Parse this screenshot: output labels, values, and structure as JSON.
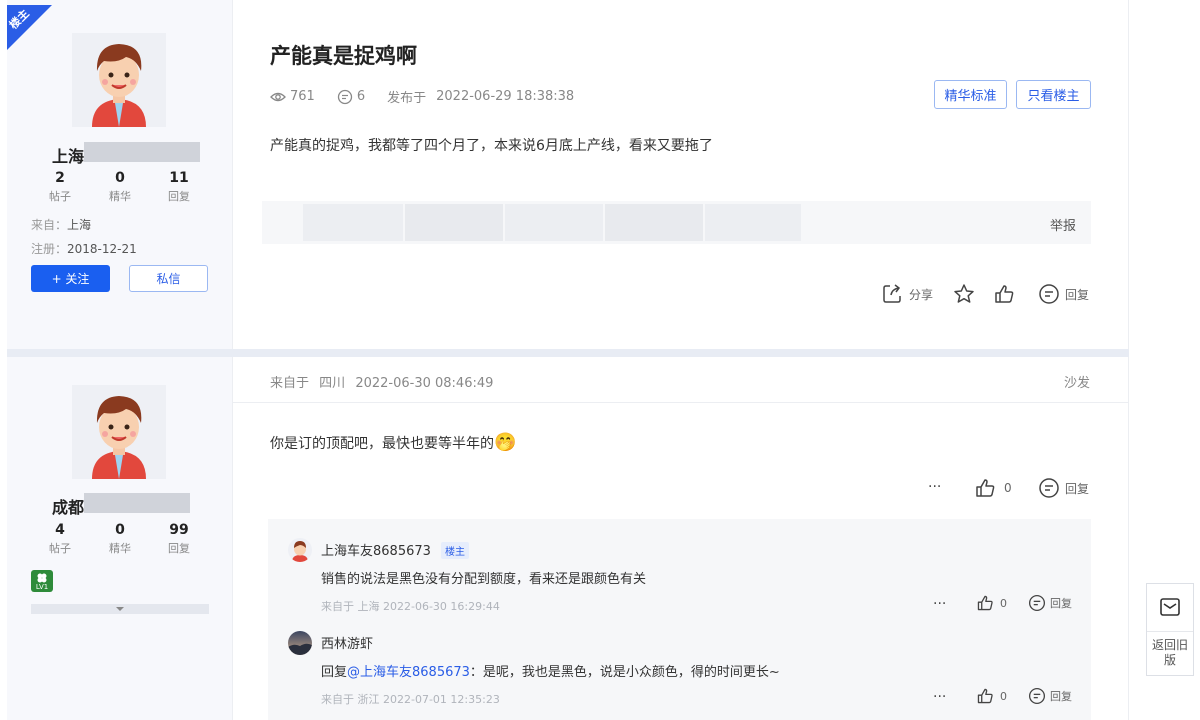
{
  "op_badge": "楼主",
  "post": {
    "title": "产能真是捉鸡啊",
    "views": "761",
    "comments": "6",
    "published_prefix": "发布于",
    "published_time": "2022-06-29 18:38:38",
    "btn_essence_standard": "精华标准",
    "btn_only_op": "只看楼主",
    "content": "产能真的捉鸡，我都等了四个月了，本来说6月底上产线，看来又要拖了",
    "report": "举报",
    "share": "分享",
    "reply": "回复"
  },
  "author": {
    "name": "上海",
    "posts": "2",
    "posts_label": "帖子",
    "essence": "0",
    "essence_label": "精华",
    "replies": "11",
    "replies_label": "回复",
    "from_label": "来自：",
    "from_value": "上海",
    "reg_label": "注册：",
    "reg_value": "2018-12-21",
    "follow_label": "+ 关注",
    "message_label": "私信"
  },
  "reply1": {
    "header_prefix": "来自于",
    "location": "四川",
    "time": "2022-06-30 08:46:49",
    "floor": "沙发",
    "content": "你是订的顶配吧，最快也要等半年的",
    "emoji": "🤭",
    "likes": "0",
    "reply": "回复",
    "more": "···",
    "user": {
      "name": "成都",
      "posts": "4",
      "posts_label": "帖子",
      "essence": "0",
      "essence_label": "精华",
      "replies": "99",
      "replies_label": "回复",
      "level": "LV1"
    }
  },
  "subreplies": [
    {
      "name": "上海车友8685673",
      "badge": "楼主",
      "content": "销售的说法是黑色没有分配到额度，看来还是跟颜色有关",
      "meta": "来自于 上海 2022-06-30 16:29:44",
      "likes": "0",
      "reply": "回复",
      "more": "···"
    },
    {
      "name": "西林游虾",
      "reply_prefix": "回复",
      "mention": "@上海车友8685673",
      "content": "：是呢，我也是黑色，说是小众颜色，得的时间更长~",
      "meta": "来自于 浙江 2022-07-01 12:35:23",
      "likes": "0",
      "reply": "回复",
      "more": "···"
    }
  ],
  "float_panel": {
    "label": "返回旧版"
  },
  "colors": {
    "accent": "#1a5ff0",
    "link": "#2a5de6",
    "divider": "#e8ecf4"
  }
}
